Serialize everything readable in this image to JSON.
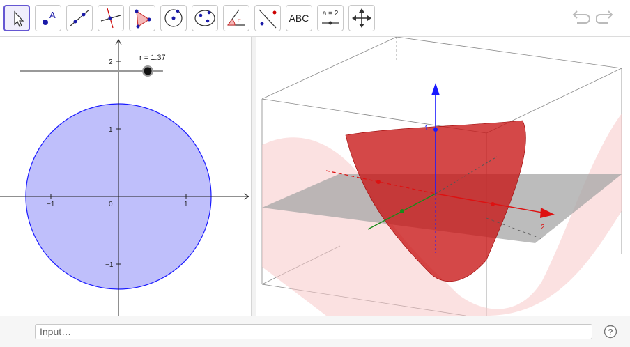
{
  "toolbar": {
    "tools": [
      {
        "name": "move-tool",
        "label": ""
      },
      {
        "name": "point-tool",
        "label": ""
      },
      {
        "name": "line-tool",
        "label": ""
      },
      {
        "name": "perpendicular-line-tool",
        "label": ""
      },
      {
        "name": "polygon-tool",
        "label": ""
      },
      {
        "name": "circle-tool",
        "label": ""
      },
      {
        "name": "conic-tool",
        "label": ""
      },
      {
        "name": "angle-tool",
        "label": ""
      },
      {
        "name": "reflect-tool",
        "label": ""
      },
      {
        "name": "text-tool",
        "label": "ABC"
      },
      {
        "name": "slider-tool",
        "label": "a = 2"
      },
      {
        "name": "move-graphics-view-tool",
        "label": ""
      }
    ],
    "active_tool": "move-tool"
  },
  "graphics2d": {
    "slider": {
      "label": "r = 1.37",
      "value": 1.37,
      "min": -2,
      "max": 2
    },
    "x_ticks": [
      "−1",
      "0",
      "1"
    ],
    "y_ticks": [
      "2",
      "1",
      "−1"
    ],
    "circle_radius": 1.37,
    "circle_fill": "#bfbffb",
    "circle_stroke": "#1a1aff"
  },
  "graphics3d": {
    "axis_labels": {
      "z": "1",
      "x": "2"
    },
    "surface_color": "#cc0000",
    "plane_color": "#a6a6a6"
  },
  "inputbar": {
    "placeholder": "Input…"
  },
  "colors": {
    "accent": "#6557d2"
  }
}
